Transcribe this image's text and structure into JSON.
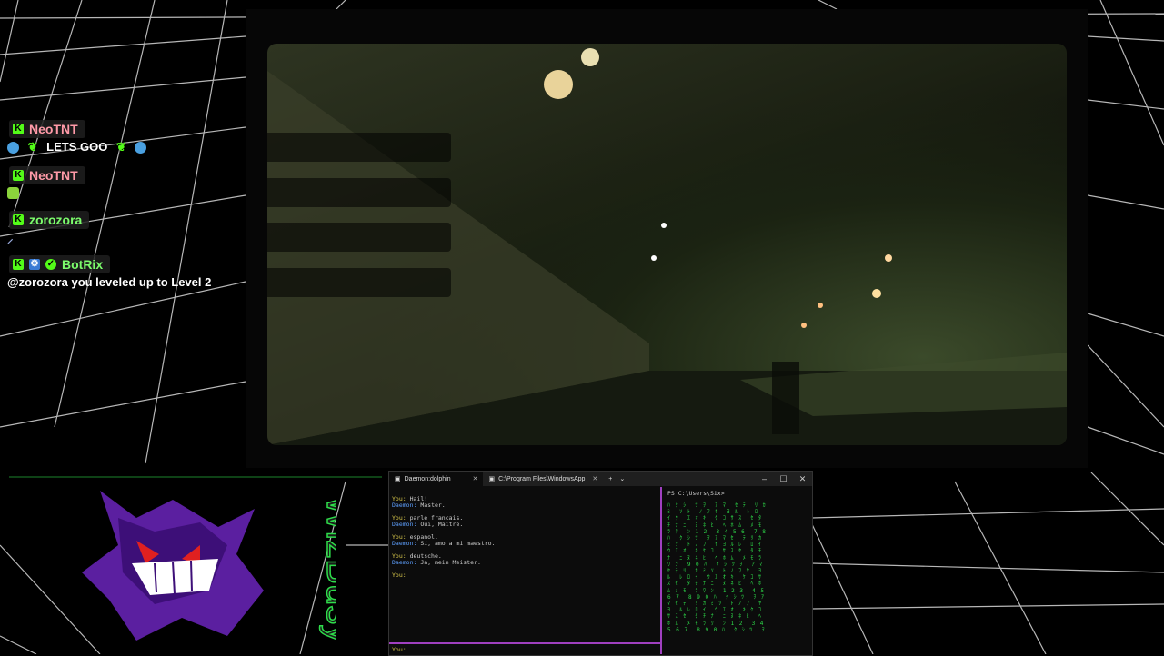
{
  "chat": {
    "messages": [
      {
        "user": "NeoTNT",
        "user_color": "#ff9aa8",
        "text": "LETS GOO"
      },
      {
        "user": "NeoTNT",
        "user_color": "#ff9aa8",
        "text": ""
      },
      {
        "user": "zorozora",
        "user_color": "#7cfc6c",
        "text": ""
      },
      {
        "user": "BotRix",
        "user_color": "#7cfc6c",
        "text": "@zorozora you leveled up to Level 2"
      }
    ]
  },
  "overlay": {
    "streamer_name": "WizBusy",
    "accent_color": "#53fc18",
    "name_color": "#2edc4a",
    "mascot_icon": "ghost-mascot-icon"
  },
  "terminal": {
    "tabs": [
      {
        "label": "Daemon:dolphin",
        "active": true
      },
      {
        "label": "C:\\Program Files\\WindowsApp",
        "active": false
      }
    ],
    "new_tab": "+",
    "dropdown": "⌄",
    "window_buttons": {
      "minimize": "–",
      "maximize": "☐",
      "close": "✕"
    },
    "conversation": [
      {
        "you": "Hail!",
        "daemon": "Master."
      },
      {
        "you": "parle francais.",
        "daemon": "Oui, Maître."
      },
      {
        "you": "espanol.",
        "daemon": "Sí, amo a mi maestro."
      },
      {
        "you": "deutsche.",
        "daemon": "Ja, mein Meister."
      }
    ],
    "you_label": "You:",
    "daemon_label": "Daemon:",
    "prompt_you": "You:",
    "bottom_prompt": "You:",
    "ps_prompt": "PS C:\\Users\\Six>",
    "accent_color": "#a040c0"
  }
}
